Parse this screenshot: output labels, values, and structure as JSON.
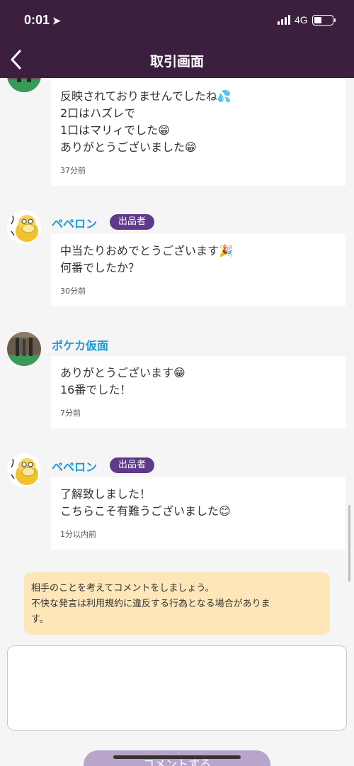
{
  "status_bar": {
    "time": "0:01",
    "network": "4G"
  },
  "header": {
    "title": "取引画面"
  },
  "messages": [
    {
      "lines": [
        "反映されておりませんでしたね💦",
        "2口はハズレで",
        "1口はマリィでした😁",
        "ありがとうございました😁"
      ],
      "time": "37分前"
    },
    {
      "name": "ペペロン",
      "badge": "出品者",
      "lines": [
        "中当たりおめでとうございます🎉",
        "何番でしたか？"
      ],
      "time": "30分前"
    },
    {
      "name": "ポケカ仮面",
      "lines": [
        "ありがとうございます😁",
        "16番でした！"
      ],
      "time": "7分前"
    },
    {
      "name": "ペペロン",
      "badge": "出品者",
      "lines": [
        "了解致しました！",
        "こちらこそ有難うございました😊"
      ],
      "time": "1分以内前"
    }
  ],
  "notice": {
    "line1": "相手のことを考えてコメントをしましょう。",
    "line2": "不快な発言は利用規約に違反する行為となる場合がありま",
    "line3": "す。"
  },
  "comment": {
    "value": "",
    "placeholder": ""
  },
  "submit_label": "コメントする"
}
